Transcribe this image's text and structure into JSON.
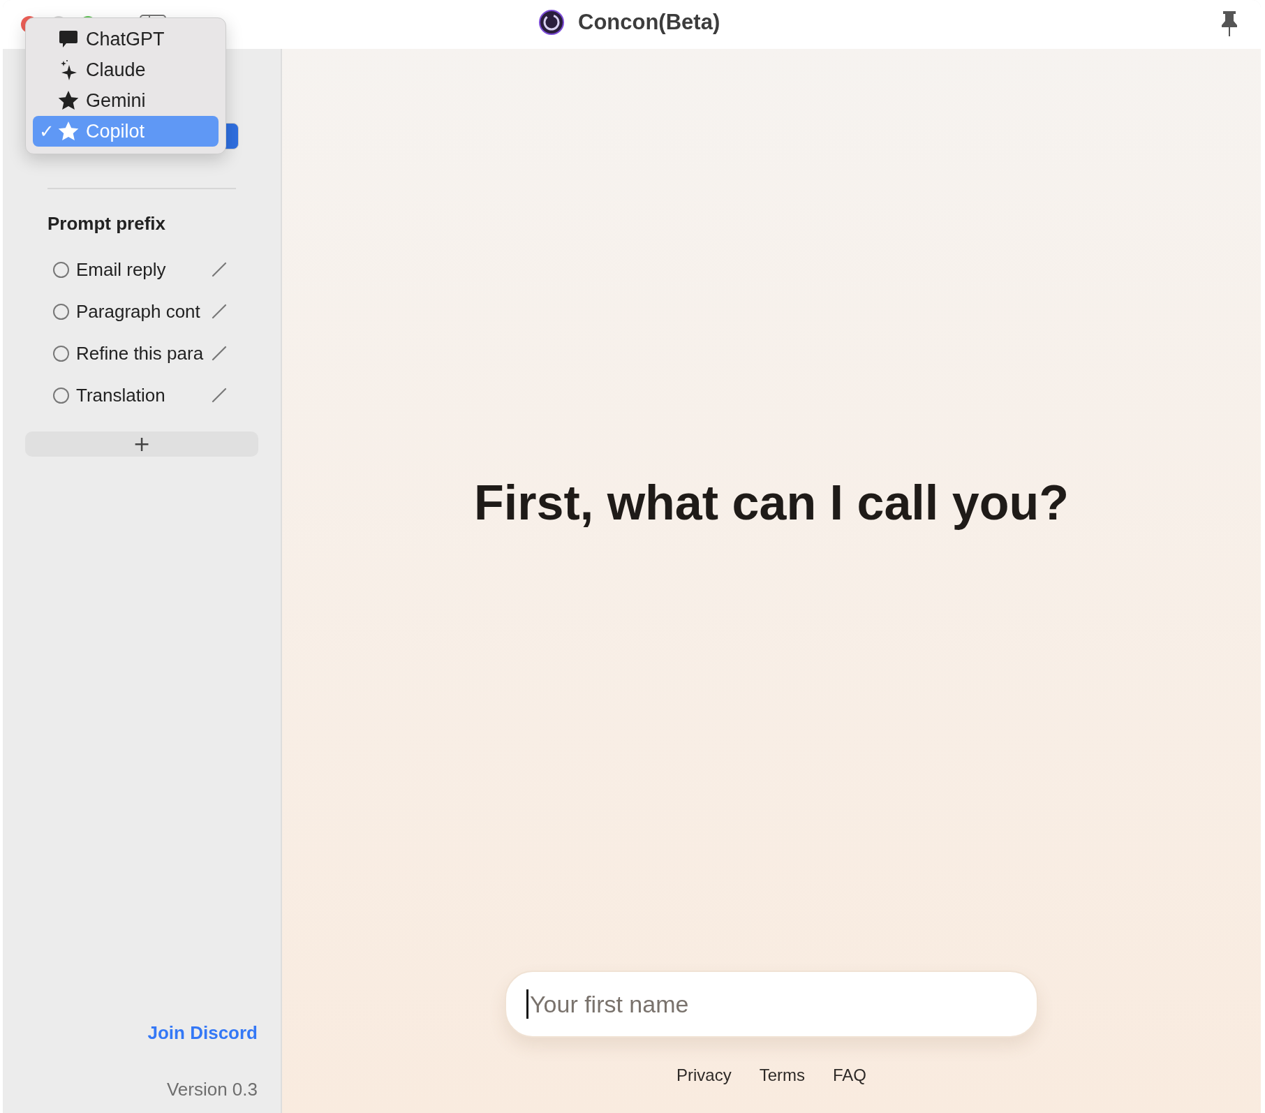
{
  "window": {
    "title": "Concon(Beta)"
  },
  "model_menu": [
    {
      "label": "ChatGPT",
      "kind": "bubble",
      "selected": false
    },
    {
      "label": "Claude",
      "kind": "sparkles",
      "selected": false
    },
    {
      "label": "Gemini",
      "kind": "star",
      "selected": false
    },
    {
      "label": "Copilot",
      "kind": "star",
      "selected": true
    }
  ],
  "check_mark": "✓",
  "sidebar": {
    "heading": "Prompt prefix",
    "prefixes": [
      {
        "label": "Email reply",
        "selected": false
      },
      {
        "label": "Paragraph cont",
        "selected": false
      },
      {
        "label": "Refine this para",
        "selected": false
      },
      {
        "label": "Translation",
        "selected": false
      }
    ],
    "add_button": "+",
    "link": "Join Discord",
    "version": "Version 0.3"
  },
  "main": {
    "heading": "First, what can I call you?",
    "name_field": {
      "placeholder": "Your first name"
    },
    "footer_links": [
      "Privacy",
      "Terms",
      "FAQ"
    ]
  }
}
